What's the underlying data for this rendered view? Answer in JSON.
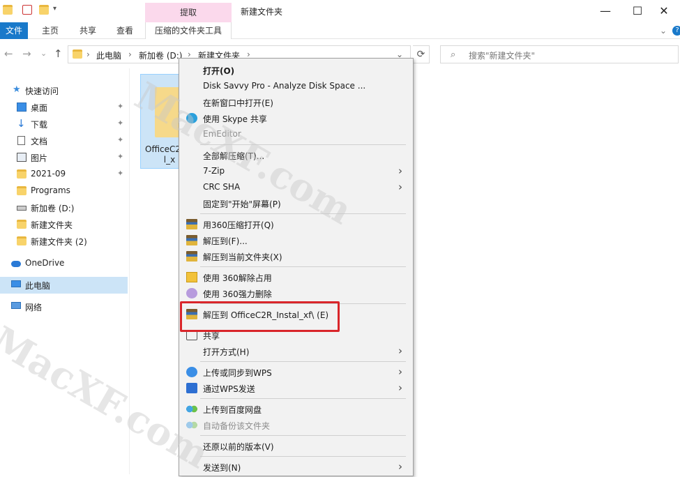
{
  "titlebar": {
    "context_tab": "提取",
    "window_title": "新建文件夹",
    "minimize": "—",
    "maximize": "☐",
    "close": "✕"
  },
  "ribbon": {
    "tabs": [
      "文件",
      "主页",
      "共享",
      "查看"
    ],
    "tools_tab": "压缩的文件夹工具",
    "expand": "⌄",
    "help": "?"
  },
  "address": {
    "back": "←",
    "forward": "→",
    "recent": "⌄",
    "up": "↑",
    "crumbs": [
      "此电脑",
      "新加卷 (D:)",
      "新建文件夹"
    ],
    "separator": "›",
    "dropdown": "⌄",
    "refresh": "⟳",
    "search_placeholder": "搜索\"新建文件夹\""
  },
  "navpane": {
    "quick_access": "快速访问",
    "items": [
      {
        "label": "桌面",
        "pinned": true,
        "icon": "desktop-icon"
      },
      {
        "label": "下载",
        "pinned": true,
        "icon": "download-icon"
      },
      {
        "label": "文档",
        "pinned": true,
        "icon": "document-icon"
      },
      {
        "label": "图片",
        "pinned": true,
        "icon": "picture-icon"
      },
      {
        "label": "2021-09",
        "pinned": true,
        "icon": "folder-icon"
      },
      {
        "label": "Programs",
        "pinned": false,
        "icon": "folder-icon"
      },
      {
        "label": "新加卷 (D:)",
        "pinned": false,
        "icon": "drive-icon"
      },
      {
        "label": "新建文件夹",
        "pinned": false,
        "icon": "folder-icon"
      },
      {
        "label": "新建文件夹 (2)",
        "pinned": false,
        "icon": "folder-icon"
      }
    ],
    "onedrive": "OneDrive",
    "this_pc": "此电脑",
    "network": "网络",
    "pin_glyph": "📌"
  },
  "file": {
    "name_line1": "OfficeC2",
    "name_line2": "l_x"
  },
  "context_menu": {
    "items": [
      {
        "label": "打开(O)",
        "bold": true
      },
      {
        "label": "Disk Savvy Pro - Analyze Disk Space ..."
      },
      {
        "label": "在新窗口中打开(E)"
      },
      {
        "label": "使用 Skype 共享",
        "icon": "skype-icon"
      },
      {
        "label": "EmEditor",
        "disabled": true
      },
      {
        "label": "全部解压缩(T)..."
      },
      {
        "label": "7-Zip",
        "submenu": true
      },
      {
        "label": "CRC SHA",
        "submenu": true
      },
      {
        "label": "固定到\"开始\"屏幕(P)"
      },
      {
        "label": "用360压缩打开(Q)",
        "icon": "zip-icon"
      },
      {
        "label": "解压到(F)...",
        "icon": "zip-icon"
      },
      {
        "label": "解压到当前文件夹(X)",
        "icon": "zip-icon"
      },
      {
        "label": "使用 360解除占用",
        "icon": "unlock-360-icon"
      },
      {
        "label": "使用 360强力删除",
        "icon": "delete-360-icon"
      },
      {
        "label": "解压到 OfficeC2R_Instal_xf\\ (E)",
        "icon": "zip-icon"
      },
      {
        "label": "共享",
        "icon": "share-icon"
      },
      {
        "label": "打开方式(H)",
        "submenu": true
      },
      {
        "label": "上传或同步到WPS",
        "icon": "wps-cloud-icon",
        "submenu": true
      },
      {
        "label": "通过WPS发送",
        "icon": "wps-send-icon",
        "submenu": true
      },
      {
        "label": "上传到百度网盘",
        "icon": "baidu-icon"
      },
      {
        "label": "自动备份该文件夹",
        "icon": "baidu-icon",
        "disabled": true
      },
      {
        "label": "还原以前的版本(V)"
      },
      {
        "label": "发送到(N)",
        "submenu": true
      }
    ],
    "submenu_glyph": "›"
  },
  "watermark": {
    "text1": "MacXF.com",
    "text2": "MacXF.com"
  },
  "colors": {
    "accent": "#1979ca",
    "selection": "#cce4f7",
    "highlight_box": "#d9252a",
    "context_tab": "#fbd9ec"
  }
}
